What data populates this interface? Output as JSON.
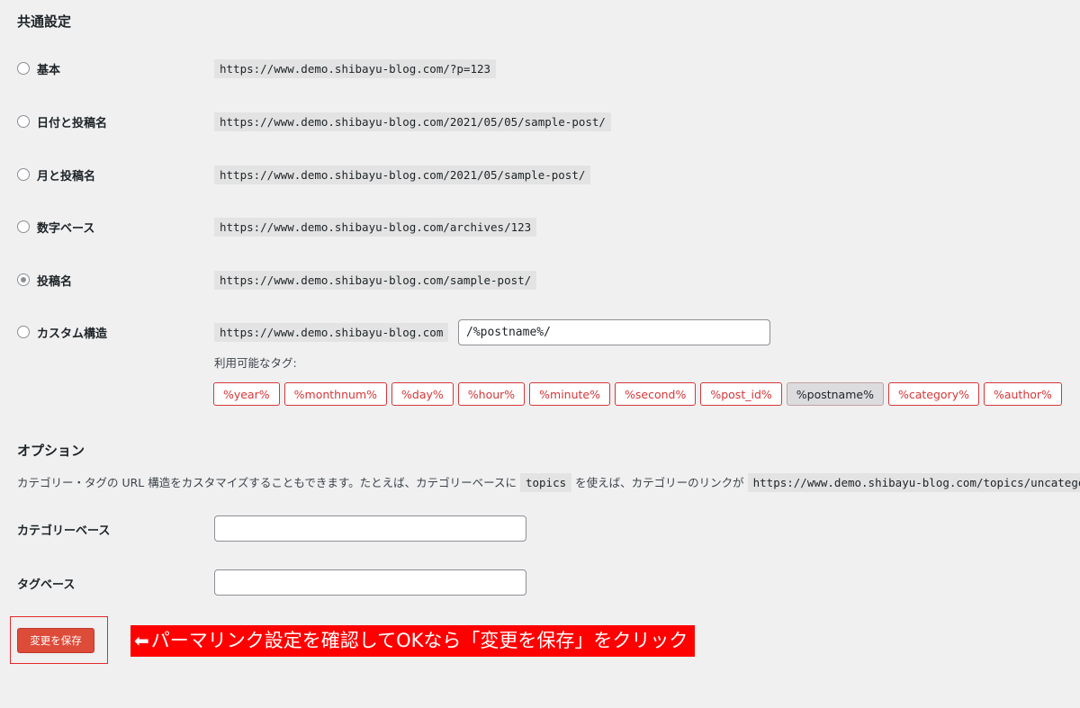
{
  "common": {
    "title": "共通設定",
    "options": [
      {
        "label": "基本",
        "url": "https://www.demo.shibayu-blog.com/?p=123",
        "checked": false
      },
      {
        "label": "日付と投稿名",
        "url": "https://www.demo.shibayu-blog.com/2021/05/05/sample-post/",
        "checked": false
      },
      {
        "label": "月と投稿名",
        "url": "https://www.demo.shibayu-blog.com/2021/05/sample-post/",
        "checked": false
      },
      {
        "label": "数字ベース",
        "url": "https://www.demo.shibayu-blog.com/archives/123",
        "checked": false
      },
      {
        "label": "投稿名",
        "url": "https://www.demo.shibayu-blog.com/sample-post/",
        "checked": true
      },
      {
        "label": "カスタム構造",
        "url": "https://www.demo.shibayu-blog.com",
        "checked": false
      }
    ],
    "custom_value": "/%postname%/",
    "available_tags_label": "利用可能なタグ:",
    "tags": [
      "%year%",
      "%monthnum%",
      "%day%",
      "%hour%",
      "%minute%",
      "%second%",
      "%post_id%",
      "%postname%",
      "%category%",
      "%author%"
    ],
    "active_tag": "%postname%"
  },
  "optional": {
    "title": "オプション",
    "desc_before": "カテゴリー・タグの URL 構造をカスタマイズすることもできます。たとえば、カテゴリーベースに",
    "desc_code1": "topics",
    "desc_middle": "を使えば、カテゴリーのリンクが",
    "desc_code2": "https://www.demo.shibayu-blog.com/topics/uncategorized/",
    "category_base_label": "カテゴリーベース",
    "category_base_value": "",
    "tag_base_label": "タグベース",
    "tag_base_value": ""
  },
  "save_button": "変更を保存",
  "annotation": {
    "icon": "left-arrow-icon",
    "text": "パーマリンク設定を確認してOKなら「変更を保存」をクリック"
  },
  "colors": {
    "accent": "#d63638",
    "annotation_bg": "#ff0000",
    "save_bg": "#dd4b39"
  }
}
